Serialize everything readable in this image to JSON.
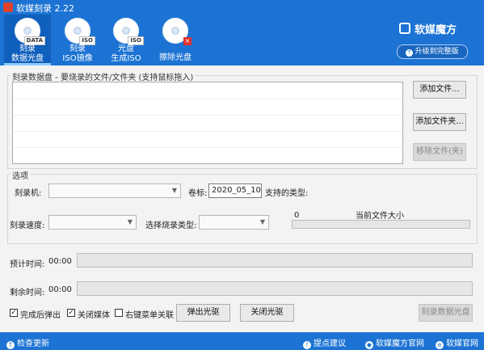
{
  "window": {
    "title": "软媒刻录 2.22"
  },
  "toolbar": {
    "tools": [
      {
        "line1": "刻录",
        "line2": "数据光盘",
        "tag": "DATA",
        "active": true
      },
      {
        "line1": "刻录",
        "line2": "ISO镜像",
        "tag": "ISO",
        "active": false
      },
      {
        "line1": "光盘",
        "line2": "生成ISO",
        "tag": "ISO",
        "active": false
      },
      {
        "line1": "擦除光盘",
        "line2": "",
        "tag": "×",
        "active": false
      }
    ],
    "brand": "软媒魔方",
    "upgrade_label": "升级到完整版"
  },
  "files_group": {
    "legend": "刻录数据盘 - 要烧录的文件/文件夹 (支持鼠标拖入)",
    "add_file": "添加文件...",
    "add_folder": "添加文件夹...",
    "remove_file": "移除文件(夹)"
  },
  "options_group": {
    "legend": "选项",
    "burner_label": "刻录机:",
    "volume_label": "卷标:",
    "volume_value": "2020_05_10",
    "supported_label": "支持的类型:",
    "speed_label": "刻录速度:",
    "burn_type_label": "选择烧录类型:",
    "size_value": "0",
    "size_label": "当前文件大小"
  },
  "progress": {
    "estimated_label": "预计时间:",
    "estimated_value": "00:00",
    "remaining_label": "剩余时间:",
    "remaining_value": "00:00"
  },
  "actions": {
    "eject_after": "完成后弹出",
    "close_media": "关闭媒体",
    "context_menu": "右键菜单关联",
    "eject_drive": "弹出光驱",
    "close_drive": "关闭光驱",
    "burn_data": "刻录数据光盘"
  },
  "footer": {
    "check_update": "检查更新",
    "suggest": "提点建议",
    "ruanmei_site": "软媒魔方官网",
    "ruanmei_web": "软媒官网"
  }
}
